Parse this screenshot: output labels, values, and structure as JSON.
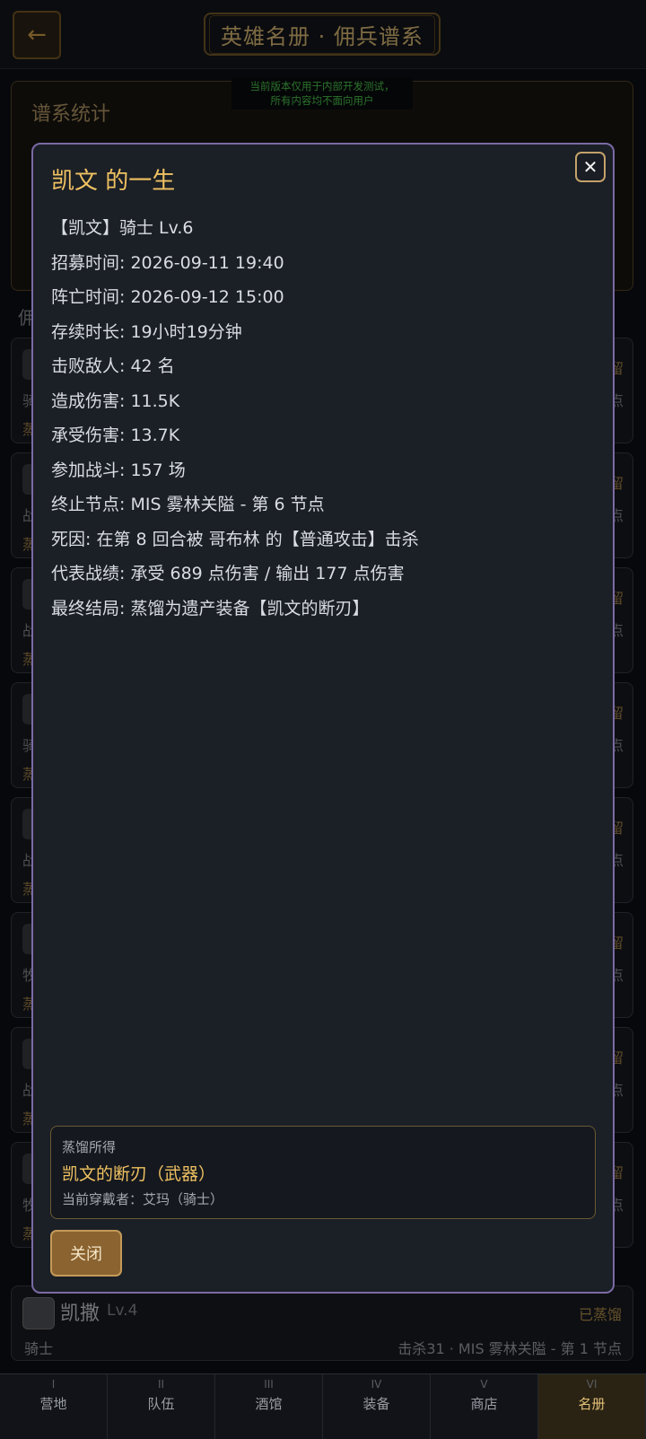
{
  "header": {
    "back_icon": "back-arrow-icon",
    "title": "英雄名册 · 佣兵谱系"
  },
  "dev_notice": {
    "line1": "当前版本仅用于内部开发测试，",
    "line2": "所有内容均不面向用户"
  },
  "stats_panel": {
    "label": "谱系统计"
  },
  "section_label": "佣",
  "background_cards": [
    {
      "tag": "留",
      "tag2": "点",
      "l1": "骑",
      "l2": "蒸"
    },
    {
      "tag": "留",
      "tag2": "点",
      "l1": "战",
      "l2": "蒸"
    },
    {
      "tag": "留",
      "tag2": "点",
      "l1": "战",
      "l2": "蒸"
    },
    {
      "tag": "留",
      "tag2": "点",
      "l1": "骑",
      "l2": "蒸"
    },
    {
      "tag": "留",
      "tag2": "点",
      "l1": "战",
      "l2": "蒸"
    },
    {
      "tag": "留",
      "tag2": "点",
      "l1": "牧",
      "l2": "蒸"
    },
    {
      "tag": "留",
      "tag2": "点",
      "l1": "战",
      "l2": "蒸"
    },
    {
      "tag": "留",
      "tag2": "点",
      "l1": "牧",
      "l2": "蒸"
    }
  ],
  "last_card": {
    "name": "凯撒",
    "level": "Lv.4",
    "status": "已蒸馏",
    "class": "骑士",
    "summary": "击杀31 · MIS 雾林关隘 - 第 1 节点"
  },
  "modal": {
    "title": "凯文 的一生",
    "close_icon": "close-icon",
    "lines": [
      "【凯文】骑士 Lv.6",
      "招募时间: 2026-09-11 19:40",
      "阵亡时间: 2026-09-12 15:00",
      "存续时长: 19小时19分钟",
      "击败敌人: 42 名",
      "造成伤害: 11.5K",
      "承受伤害: 13.7K",
      "参加战斗: 157 场",
      "终止节点: MIS 雾林关隘 - 第 6 节点",
      "死因: 在第 8 回合被 哥布林 的【普通攻击】击杀",
      "代表战绩: 承受 689 点伤害 / 输出 177 点伤害",
      "最终结局: 蒸馏为遗产装备【凯文的断刃】"
    ],
    "loot": {
      "label": "蒸馏所得",
      "item": "凯文的断刃（武器）",
      "wearer": "当前穿戴者：艾玛（骑士）"
    },
    "close_button": "关闭"
  },
  "nav": [
    {
      "num": "I",
      "label": "营地"
    },
    {
      "num": "II",
      "label": "队伍"
    },
    {
      "num": "III",
      "label": "酒馆"
    },
    {
      "num": "IV",
      "label": "装备"
    },
    {
      "num": "V",
      "label": "商店"
    },
    {
      "num": "VI",
      "label": "名册",
      "active": true
    }
  ]
}
